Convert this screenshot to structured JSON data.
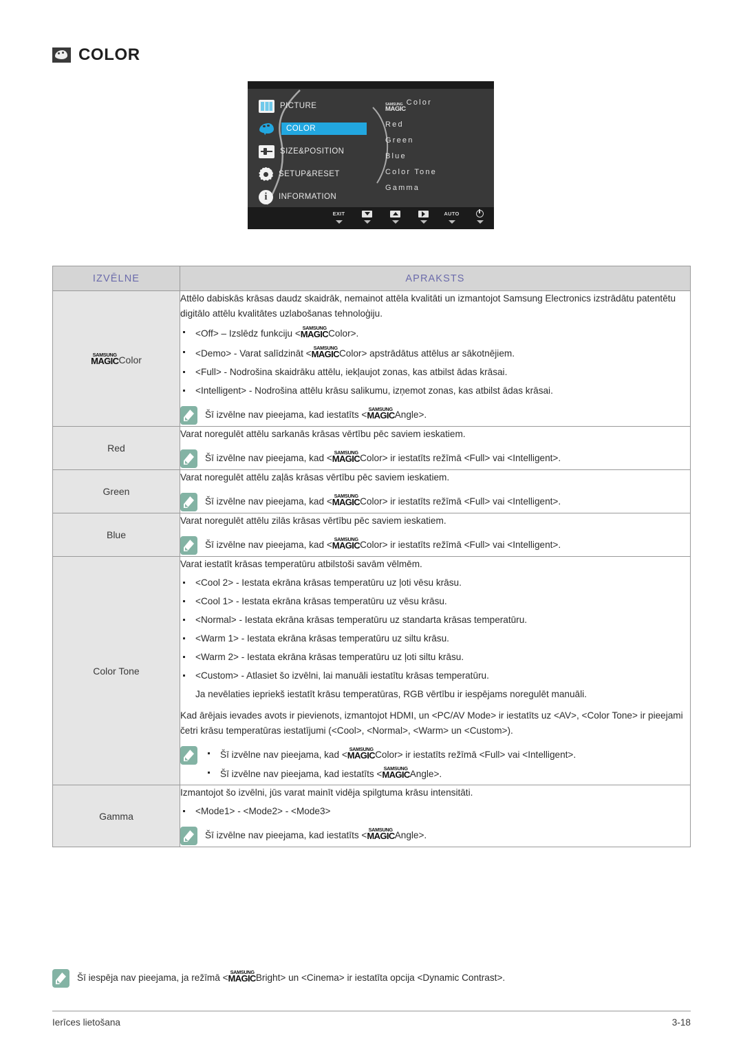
{
  "page": {
    "heading": "COLOR",
    "heading_icon": "palette-icon",
    "footer_left": "Ierīces lietošana",
    "footer_right": "3-18"
  },
  "osd": {
    "left_menu": [
      {
        "label": "PICTURE",
        "icon": "picture-icon",
        "selected": false
      },
      {
        "label": "COLOR",
        "icon": "palette-icon",
        "selected": true
      },
      {
        "label": "SIZE&POSITION",
        "icon": "size-position-icon",
        "selected": false
      },
      {
        "label": "SETUP&RESET",
        "icon": "gear-icon",
        "selected": false
      },
      {
        "label": "INFORMATION",
        "icon": "info-icon",
        "selected": false
      }
    ],
    "right_menu": [
      {
        "prefix_logo": true,
        "logo_top": "SAMSUNG",
        "logo_bottom": "MAGIC",
        "label": "Color"
      },
      {
        "prefix_logo": false,
        "label": "Red"
      },
      {
        "prefix_logo": false,
        "label": "Green"
      },
      {
        "prefix_logo": false,
        "label": "Blue"
      },
      {
        "prefix_logo": false,
        "label": "Color Tone"
      },
      {
        "prefix_logo": false,
        "label": "Gamma"
      }
    ],
    "bottom_bar": [
      {
        "label": "EXIT",
        "icon": "exit-label"
      },
      {
        "label": "",
        "icon": "arrow-down-icon"
      },
      {
        "label": "",
        "icon": "arrow-up-icon"
      },
      {
        "label": "",
        "icon": "arrow-right-icon"
      },
      {
        "label": "AUTO",
        "icon": "auto-label"
      },
      {
        "label": "",
        "icon": "power-icon"
      }
    ]
  },
  "table": {
    "headers": {
      "menu": "IZVĒLNE",
      "description": "APRAKSTS"
    },
    "logo": {
      "top": "SAMSUNG",
      "bottom": "MAGIC"
    },
    "rows": {
      "magiccolor": {
        "menu_suffix": "Color",
        "intro": "Attēlo dabiskās krāsas daudz skaidrāk, nemainot attēla kvalitāti un izmantojot Samsung Electronics izstrādātu patentētu digitālo attēlu kvalitātes uzlabošanas tehnoloģiju.",
        "bullets": [
          {
            "pre": "<Off> – Izslēdz funkciju <",
            "post": "Color>."
          },
          {
            "pre": "<Demo> - Varat salīdzināt <",
            "post": "Color> apstrādātus attēlus ar sākotnējiem."
          },
          {
            "pre": "<Full> - Nodrošina skaidrāku attēlu, iekļaujot zonas, kas atbilst ādas krāsai.",
            "post": ""
          },
          {
            "pre": "<Intelligent> - Nodrošina attēlu krāsu salikumu, izņemot zonas, kas atbilst ādas krāsai.",
            "post": ""
          }
        ],
        "note": {
          "pre": "Šī izvēlne nav pieejama, kad iestatīts <",
          "post": "Angle>."
        }
      },
      "red": {
        "menu": "Red",
        "intro": "Varat noregulēt attēlu sarkanās krāsas vērtību pēc saviem ieskatiem.",
        "note": {
          "pre": "Šī izvēlne nav pieejama, kad <",
          "post": "Color> ir iestatīts režīmā <Full> vai <Intelligent>."
        }
      },
      "green": {
        "menu": "Green",
        "intro": "Varat noregulēt attēlu zaļās krāsas vērtību pēc saviem ieskatiem.",
        "note": {
          "pre": "Šī izvēlne nav pieejama, kad <",
          "post": "Color> ir iestatīts režīmā <Full> vai <Intelligent>."
        }
      },
      "blue": {
        "menu": "Blue",
        "intro": "Varat noregulēt attēlu zilās krāsas vērtību pēc saviem ieskatiem.",
        "note": {
          "pre": "Šī izvēlne nav pieejama, kad <",
          "post": "Color> ir iestatīts režīmā <Full> vai <Intelligent>."
        }
      },
      "colortone": {
        "menu": "Color Tone",
        "intro": "Varat iestatīt krāsas temperatūru atbilstoši savām vēlmēm.",
        "bullets": [
          "<Cool 2> - Iestata ekrāna krāsas temperatūru uz ļoti vēsu krāsu.",
          "<Cool 1> - Iestata ekrāna krāsas temperatūru uz vēsu krāsu.",
          "<Normal> - Iestata ekrāna krāsas temperatūru uz standarta krāsas temperatūru.",
          "<Warm 1> - Iestata ekrāna krāsas temperatūru uz siltu krāsu.",
          "<Warm 2> - Iestata ekrāna krāsas temperatūru uz ļoti siltu krāsu.",
          "<Custom> - Atlasiet šo izvēlni, lai manuāli iestatītu krāsas temperatūru."
        ],
        "sub_note": "Ja nevēlaties iepriekš iestatīt krāsu temperatūras, RGB vērtību ir iespējams noregulēt manuāli.",
        "paragraph": "Kad ārējais ievades avots ir pievienots, izmantojot HDMI, un <PC/AV Mode> ir iestatīts uz <AV>, <Color Tone> ir pieejami četri krāsu temperatūras iestatījumi (<Cool>, <Normal>, <Warm> un <Custom>).",
        "notes": [
          {
            "pre": "Šī izvēlne nav pieejama, kad <",
            "post": "Color> ir iestatīts režīmā <Full> vai <Intelligent>."
          },
          {
            "pre": "Šī izvēlne nav pieejama, kad iestatīts <",
            "post": "Angle>."
          }
        ]
      },
      "gamma": {
        "menu": "Gamma",
        "intro": "Izmantojot šo izvēlni, jūs varat mainīt vidēja spilgtuma krāsu intensitāti.",
        "bullets": [
          "<Mode1> - <Mode2> - <Mode3>"
        ],
        "note": {
          "pre": "Šī izvēlne nav pieejama, kad iestatīts <",
          "post": "Angle>."
        }
      }
    }
  },
  "bottom_note": {
    "pre": "Šī iespēja nav pieejama, ja režīmā <",
    "post": "Bright> un <Cinema> ir iestatīta opcija <Dynamic Contrast>."
  },
  "colors": {
    "header_bg": "#d5d5d5",
    "header_text": "#6b6bab",
    "menu_col_bg": "#e5e5e5",
    "osd_bg": "#393939",
    "osd_accent": "#22a7e0",
    "note_icon_bg": "#83b3a4"
  }
}
